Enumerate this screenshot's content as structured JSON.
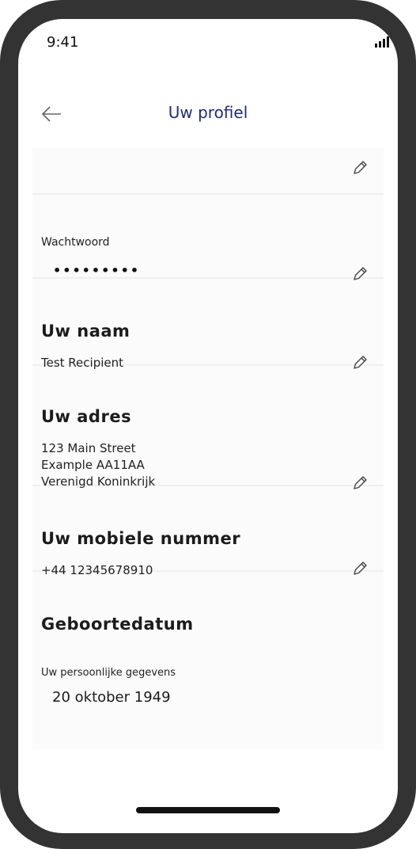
{
  "status_bar": {
    "time": "9:41",
    "icons": [
      "signal-icon",
      "wifi-icon",
      "battery-icon"
    ]
  },
  "header": {
    "back_icon": "arrow-left-icon",
    "title": "Uw profiel"
  },
  "profile": {
    "password": {
      "label": "Wachtwoord",
      "value": "•••••••••"
    },
    "name": {
      "heading": "Uw naam",
      "value": "Test Recipient"
    },
    "address": {
      "heading": "Uw adres",
      "lines": [
        "123 Main Street",
        "Example AA11AA",
        "Verenigd Koninkrijk"
      ]
    },
    "mobile": {
      "heading": "Uw mobiele nummer",
      "value": "+44 12345678910"
    },
    "dob": {
      "heading": "Geboortedatum",
      "label": "Uw persoonlijke gegevens",
      "value": "20 oktober 1949"
    }
  },
  "colors": {
    "title": "#1f2d7a",
    "frame": "#333333",
    "section_bg": "#fbfbfb"
  }
}
